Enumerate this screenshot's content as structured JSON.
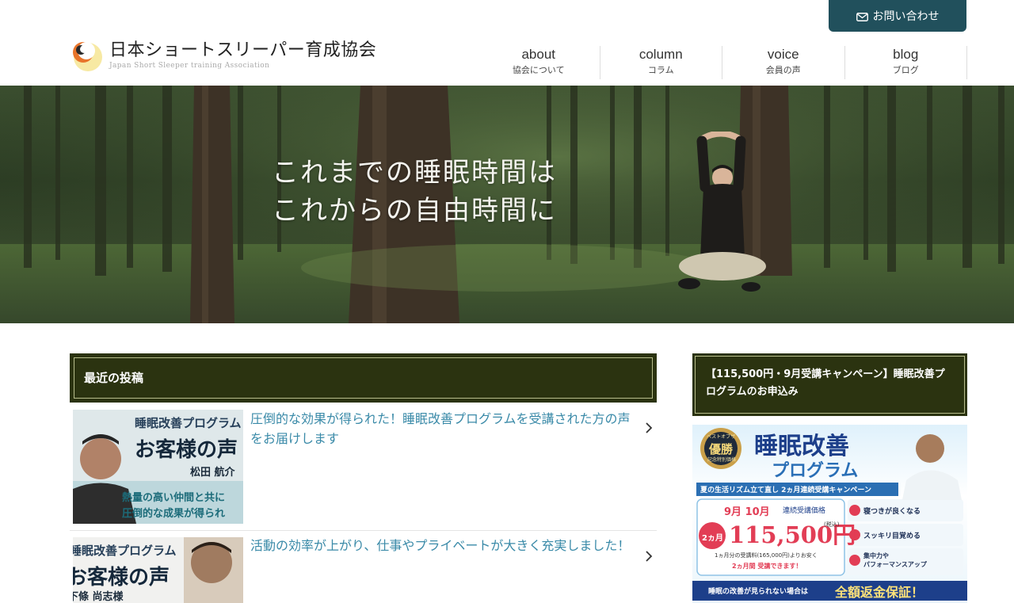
{
  "header": {
    "contact_label": "お問い合わせ",
    "logo_title": "日本ショートスリーパー育成協会",
    "logo_sub": "Japan Short Sleeper training Association",
    "nav": [
      {
        "en": "about",
        "ja": "協会について"
      },
      {
        "en": "column",
        "ja": "コラム"
      },
      {
        "en": "voice",
        "ja": "会員の声"
      },
      {
        "en": "blog",
        "ja": "ブログ"
      }
    ]
  },
  "hero": {
    "line1": "これまでの睡眠時間は",
    "line2": "これからの自由時間に"
  },
  "recent": {
    "heading": "最近の投稿",
    "posts": [
      {
        "title": "圧倒的な効果が得られた！睡眠改善プログラムを受講された方の声をお届けします",
        "thumb_top": "睡眠改善プログラム",
        "thumb_main": "お客様の声",
        "thumb_name": "松田 航介",
        "thumb_line1": "熱量の高い仲間と共に",
        "thumb_line2": "圧倒的な成果が得られ"
      },
      {
        "title": "活動の効率が上がり、仕事やプライベートが大きく充実しました！",
        "thumb_top": "睡眠改善プログラム",
        "thumb_main": "お客様の声",
        "thumb_name": "下條 尚志様"
      }
    ]
  },
  "sidebar": {
    "campaign_title": "【115,500円・9月受講キャンペーン】睡眠改善プログラムのお申込み",
    "banner": {
      "award": "優勝",
      "award_top": "ベストオブザ",
      "award_bottom": "記念特別価格",
      "heading": "睡眠改善",
      "subheading": "プログラム",
      "ribbon": "夏の生活リズム立て直し 2ヵ月連続受講キャンペーン",
      "months": "9月 10月",
      "price_label": "連続受講価格",
      "period": "2ヵ月",
      "price": "115,500円",
      "tax": "(税込)",
      "note1": "1ヵ月分の受講料(165,000円)よりお安く",
      "note2": "2ヵ月間 受講できます！",
      "benefits": [
        "寝つきが良くなる",
        "スッキリ目覚める",
        "集中力や\nパフォーマンスアップ"
      ],
      "footer_small": "睡眠の改善が見られない場合は",
      "footer_big": "全額返金保証！"
    }
  },
  "colors": {
    "contact_bg": "#21505c",
    "heading_bg": "#2b3310",
    "link": "#3a8aa8"
  }
}
